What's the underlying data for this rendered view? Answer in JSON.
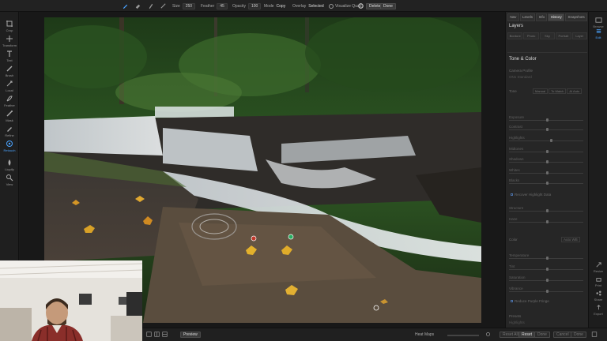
{
  "toolbar": {
    "size_label": "Size",
    "size_value": "250",
    "feather_label": "Feather",
    "feather_value": "45",
    "opacity_label": "Opacity",
    "opacity_value": "100",
    "mode_label": "Mode",
    "mode_value": "Copy",
    "overlay_label": "Overlay",
    "overlay_value": "Selected",
    "visualize_label": "Visualize Quad",
    "delete_label": "Delete",
    "done_label": "Done"
  },
  "left_tools": [
    {
      "label": "Crop",
      "icon": "crop-icon"
    },
    {
      "label": "Transform",
      "icon": "transform-icon"
    },
    {
      "label": "Text",
      "icon": "text-icon"
    },
    {
      "label": "Brush",
      "icon": "brush-icon"
    },
    {
      "label": "Local",
      "icon": "local-icon"
    },
    {
      "label": "Feather",
      "icon": "feather-icon"
    },
    {
      "label": "Mask",
      "icon": "mask-icon"
    },
    {
      "label": "Refine",
      "icon": "refine-icon"
    },
    {
      "label": "Retouch",
      "icon": "retouch-icon"
    },
    {
      "label": "Liquify",
      "icon": "liquify-icon"
    },
    {
      "label": "View",
      "icon": "view-icon"
    }
  ],
  "right_tabs": [
    "Nav",
    "Levels",
    "Info",
    "History",
    "Snapshots"
  ],
  "right_panel": {
    "layers_title": "Layers",
    "layer_tabs": [
      "Bordure",
      "Photo",
      "Sky",
      "Portrait",
      "Layer"
    ],
    "tone_title": "Tone & Color",
    "camera_profile_label": "Camera Profile",
    "camera_profile_value": "ON1 Standard",
    "tone_label": "Tone",
    "tone_buttons": [
      "Manual",
      "To Match",
      "AI Auto"
    ],
    "tone_sliders": [
      "Exposure",
      "Contrast",
      "Highlights",
      "Midtones",
      "Shadows",
      "Whites",
      "Blacks"
    ],
    "recover_label": "Recover Highlight Data",
    "detail_sliders": [
      "Structure",
      "Haze"
    ],
    "color_label": "Color",
    "color_auto": "Auto WB",
    "color_sliders": [
      "Temperature",
      "Tint",
      "Saturation",
      "Vibrance"
    ],
    "purple_label": "Reduce Purple Fringe",
    "presets_label": "Presets",
    "highlights_label": "Highlights"
  },
  "right_tools": [
    {
      "label": "Browse",
      "icon": "browse-icon"
    },
    {
      "label": "Edit",
      "icon": "edit-icon"
    },
    {
      "label": "Resize",
      "icon": "resize-icon"
    },
    {
      "label": "Print",
      "icon": "print-icon"
    },
    {
      "label": "Share",
      "icon": "share-icon"
    },
    {
      "label": "Export",
      "icon": "export-icon"
    }
  ],
  "bottombar": {
    "preview_label": "Preview",
    "heatmaps_label": "Heat Maps",
    "reset_all_label": "Reset All",
    "reset_label": "Reset",
    "done_label": "Done",
    "cancel_label": "Cancel",
    "done2_label": "Done"
  },
  "colors": {
    "accent": "#4aa3ff",
    "panel_bg": "#262626",
    "toolbar_bg": "#222222"
  }
}
